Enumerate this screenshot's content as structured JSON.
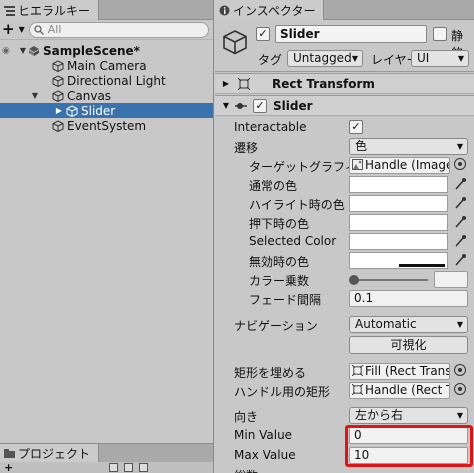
{
  "hierarchy": {
    "tab_label": "ヒエラルキー",
    "add_label": "+",
    "search_placeholder": "All",
    "items": [
      {
        "label": "SampleScene*"
      },
      {
        "label": "Main Camera"
      },
      {
        "label": "Directional Light"
      },
      {
        "label": "Canvas"
      },
      {
        "label": "Slider"
      },
      {
        "label": "EventSystem"
      }
    ]
  },
  "project": {
    "tab_label": "プロジェクト"
  },
  "inspector": {
    "tab_label": "インスペクター",
    "object_name": "Slider",
    "static_label": "静的",
    "tag_label": "タグ",
    "tag_value": "Untagged",
    "layer_label": "レイヤー",
    "layer_value": "UI",
    "components": {
      "rect_transform": "Rect Transform",
      "slider": "Slider"
    },
    "props": {
      "interactable": "Interactable",
      "transition": "遷移",
      "transition_value": "色",
      "target_graphic": "ターゲットグラフィックス",
      "target_graphic_value": "Handle (Image)",
      "normal_color": "通常の色",
      "highlighted_color": "ハイライト時の色",
      "pressed_color": "押下時の色",
      "selected_color": "Selected Color",
      "disabled_color": "無効時の色",
      "color_multiplier": "カラー乗数",
      "fade_duration": "フェード間隔",
      "fade_duration_value": "0.1",
      "navigation": "ナビゲーション",
      "navigation_value": "Automatic",
      "visualize": "可視化",
      "fill_rect": "矩形を埋める",
      "fill_rect_value": "Fill (Rect Transfo",
      "handle_rect": "ハンドル用の矩形",
      "handle_rect_value": "Handle (Rect Tra",
      "direction": "向き",
      "direction_value": "左から右",
      "min_value": "Min Value",
      "min_value_value": "0",
      "max_value": "Max Value",
      "max_value_value": "10",
      "whole_numbers": "総数"
    },
    "color_multiplier_level": 0,
    "highlight_color": "#e01414"
  },
  "colors": {
    "selection": "#3a72b0",
    "panel": "#c8c8c8"
  }
}
